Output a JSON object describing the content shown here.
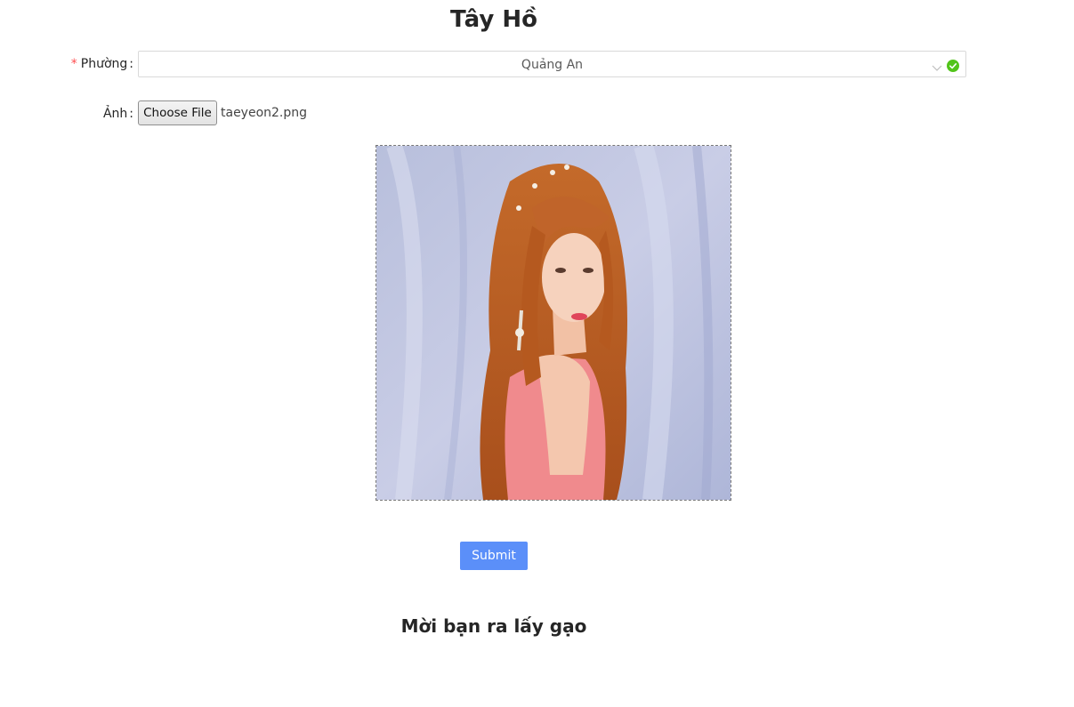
{
  "header": {
    "title": "Tây Hồ"
  },
  "form": {
    "ward": {
      "required_mark": "*",
      "label": "Phường",
      "colon": ":",
      "selected_value": "Quảng An",
      "arrow_icon": "chevron-down-icon",
      "status_icon": "check-circle-icon",
      "status_color": "#52c41a"
    },
    "image": {
      "label": "Ảnh",
      "colon": ":",
      "choose_file_label": "Choose File",
      "file_name": "taeyeon2.png"
    },
    "submit_label": "Submit"
  },
  "result": {
    "message": "Mời bạn ra lấy gạo"
  },
  "colors": {
    "primary": "#5b8ff9",
    "required": "#ff4d4f",
    "text": "#262626"
  }
}
